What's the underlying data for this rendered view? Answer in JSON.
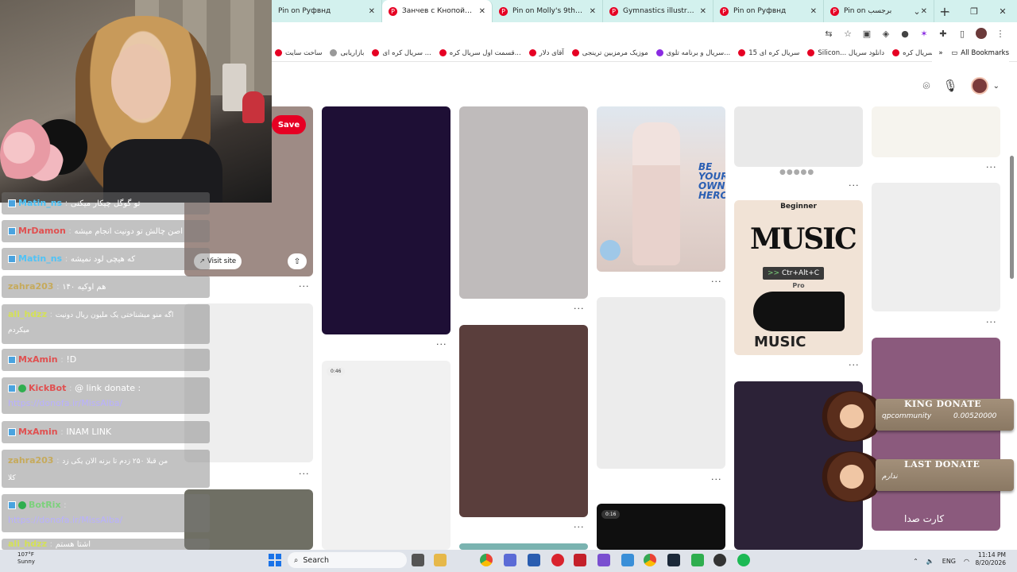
{
  "browser": {
    "tabs": [
      {
        "title": "Pin on Руфвнд"
      },
      {
        "title": "Занчев с Кнопой 😍💜"
      },
      {
        "title": "Pin on Molly's 9th birthd"
      },
      {
        "title": "Gymnastics illustration"
      },
      {
        "title": "Pin on Руфвнд"
      },
      {
        "title": "Pin on برجسب"
      }
    ],
    "new_tab": "+",
    "window_controls": [
      "⌄",
      "—",
      "❐",
      "✕"
    ],
    "bookmarks": [
      "ساخت سایت",
      "بازاریابی",
      "سریال کره ای ...",
      "قسمت اول سریال کره...",
      "آقای دلار",
      "موزیک مرمزبین ترینجی",
      "سریال و برنامه تلوی...",
      "15 سریال کره ای",
      "Silicon... دانلود سریال",
      "قسمت اول سریال کره..."
    ],
    "all_bookmarks": "All Bookmarks"
  },
  "pins": {
    "save_label": "Save",
    "visit_label": "Visit site",
    "video_badge_1": "0:46",
    "video_badge_2": "0:16",
    "tooltip": "Ctr+Alt+C",
    "music_top": "Beginner",
    "music_word_1": "MUSIC",
    "music_pro": "Pro",
    "music_word_2": "MUSIC",
    "fashion_text": "BE YOUR OWN HERO",
    "colors": {
      "dark_purple": "#1e0f35",
      "brown": "#5a3e3c",
      "mauve": "#8b5a7d",
      "gray": "#bfbbbb"
    }
  },
  "chat": {
    "messages": [
      {
        "user": "Matin_ns",
        "text": "تو گوگل چیکار میکنی",
        "color": "#4fc3f7"
      },
      {
        "user": "MrDamon",
        "text": "اصن چالش تو دونیت انجام میشه",
        "color": "#e05050"
      },
      {
        "user": "Matin_ns",
        "text": "که هیچی لود نمیشه",
        "color": "#4fc3f7"
      },
      {
        "user": "zahra203",
        "text": "هم اوکیه ۱۴۰",
        "color": "#c8a030"
      },
      {
        "user": "ali_hdzz",
        "text": "اگه منو میشناختی یک ملیون ریال دونیت",
        "text2": "میکردم",
        "color": "#d4e157"
      },
      {
        "user": "MxAmin",
        "text": "!D",
        "color": "#e05050"
      },
      {
        "user": "KickBot",
        "text": "@ link donate :",
        "link": "https://donofa.ir/MissAlba/",
        "color": "#e05050"
      },
      {
        "user": "MxAmin",
        "text": "INAM LINK",
        "color": "#e05050"
      },
      {
        "user": "zahra203",
        "text": "من قبلا ۲۵۰ زدم تا بزنه الان یکی زد",
        "text2": "کلا",
        "color": "#c8a030"
      },
      {
        "user": "BotRix",
        "text": ":",
        "link": "https://donofa.ir/MissAlba/",
        "color": "#7cd17c"
      },
      {
        "user": "ali_hdzz",
        "text": "اشتا هستم",
        "color": "#d4e157"
      }
    ]
  },
  "donations": {
    "king": {
      "title": "KING DONATE",
      "user": "qpcommunity",
      "amount": "0.00520000"
    },
    "last": {
      "title": "LAST DONATE",
      "user": "ندارم"
    },
    "card": "کارت صدا"
  },
  "taskbar": {
    "weather_temp": "107°F",
    "weather_desc": "Sunny",
    "search_label": "Search",
    "lang": "ENG",
    "time": "11:14 PM",
    "date": "8/20/2026"
  }
}
